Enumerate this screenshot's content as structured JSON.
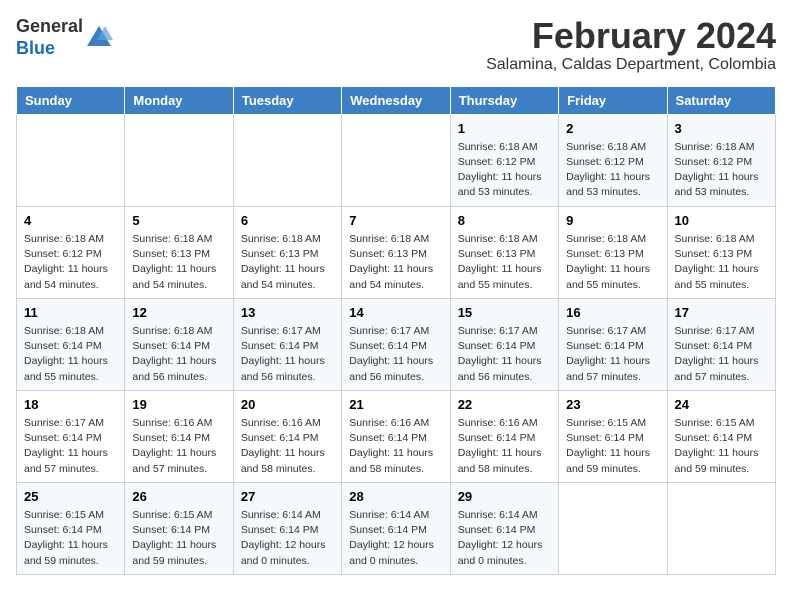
{
  "header": {
    "logo_general": "General",
    "logo_blue": "Blue",
    "month_year": "February 2024",
    "location": "Salamina, Caldas Department, Colombia"
  },
  "weekdays": [
    "Sunday",
    "Monday",
    "Tuesday",
    "Wednesday",
    "Thursday",
    "Friday",
    "Saturday"
  ],
  "weeks": [
    [
      {
        "day": "",
        "info": ""
      },
      {
        "day": "",
        "info": ""
      },
      {
        "day": "",
        "info": ""
      },
      {
        "day": "",
        "info": ""
      },
      {
        "day": "1",
        "info": "Sunrise: 6:18 AM\nSunset: 6:12 PM\nDaylight: 11 hours\nand 53 minutes."
      },
      {
        "day": "2",
        "info": "Sunrise: 6:18 AM\nSunset: 6:12 PM\nDaylight: 11 hours\nand 53 minutes."
      },
      {
        "day": "3",
        "info": "Sunrise: 6:18 AM\nSunset: 6:12 PM\nDaylight: 11 hours\nand 53 minutes."
      }
    ],
    [
      {
        "day": "4",
        "info": "Sunrise: 6:18 AM\nSunset: 6:12 PM\nDaylight: 11 hours\nand 54 minutes."
      },
      {
        "day": "5",
        "info": "Sunrise: 6:18 AM\nSunset: 6:13 PM\nDaylight: 11 hours\nand 54 minutes."
      },
      {
        "day": "6",
        "info": "Sunrise: 6:18 AM\nSunset: 6:13 PM\nDaylight: 11 hours\nand 54 minutes."
      },
      {
        "day": "7",
        "info": "Sunrise: 6:18 AM\nSunset: 6:13 PM\nDaylight: 11 hours\nand 54 minutes."
      },
      {
        "day": "8",
        "info": "Sunrise: 6:18 AM\nSunset: 6:13 PM\nDaylight: 11 hours\nand 55 minutes."
      },
      {
        "day": "9",
        "info": "Sunrise: 6:18 AM\nSunset: 6:13 PM\nDaylight: 11 hours\nand 55 minutes."
      },
      {
        "day": "10",
        "info": "Sunrise: 6:18 AM\nSunset: 6:13 PM\nDaylight: 11 hours\nand 55 minutes."
      }
    ],
    [
      {
        "day": "11",
        "info": "Sunrise: 6:18 AM\nSunset: 6:14 PM\nDaylight: 11 hours\nand 55 minutes."
      },
      {
        "day": "12",
        "info": "Sunrise: 6:18 AM\nSunset: 6:14 PM\nDaylight: 11 hours\nand 56 minutes."
      },
      {
        "day": "13",
        "info": "Sunrise: 6:17 AM\nSunset: 6:14 PM\nDaylight: 11 hours\nand 56 minutes."
      },
      {
        "day": "14",
        "info": "Sunrise: 6:17 AM\nSunset: 6:14 PM\nDaylight: 11 hours\nand 56 minutes."
      },
      {
        "day": "15",
        "info": "Sunrise: 6:17 AM\nSunset: 6:14 PM\nDaylight: 11 hours\nand 56 minutes."
      },
      {
        "day": "16",
        "info": "Sunrise: 6:17 AM\nSunset: 6:14 PM\nDaylight: 11 hours\nand 57 minutes."
      },
      {
        "day": "17",
        "info": "Sunrise: 6:17 AM\nSunset: 6:14 PM\nDaylight: 11 hours\nand 57 minutes."
      }
    ],
    [
      {
        "day": "18",
        "info": "Sunrise: 6:17 AM\nSunset: 6:14 PM\nDaylight: 11 hours\nand 57 minutes."
      },
      {
        "day": "19",
        "info": "Sunrise: 6:16 AM\nSunset: 6:14 PM\nDaylight: 11 hours\nand 57 minutes."
      },
      {
        "day": "20",
        "info": "Sunrise: 6:16 AM\nSunset: 6:14 PM\nDaylight: 11 hours\nand 58 minutes."
      },
      {
        "day": "21",
        "info": "Sunrise: 6:16 AM\nSunset: 6:14 PM\nDaylight: 11 hours\nand 58 minutes."
      },
      {
        "day": "22",
        "info": "Sunrise: 6:16 AM\nSunset: 6:14 PM\nDaylight: 11 hours\nand 58 minutes."
      },
      {
        "day": "23",
        "info": "Sunrise: 6:15 AM\nSunset: 6:14 PM\nDaylight: 11 hours\nand 59 minutes."
      },
      {
        "day": "24",
        "info": "Sunrise: 6:15 AM\nSunset: 6:14 PM\nDaylight: 11 hours\nand 59 minutes."
      }
    ],
    [
      {
        "day": "25",
        "info": "Sunrise: 6:15 AM\nSunset: 6:14 PM\nDaylight: 11 hours\nand 59 minutes."
      },
      {
        "day": "26",
        "info": "Sunrise: 6:15 AM\nSunset: 6:14 PM\nDaylight: 11 hours\nand 59 minutes."
      },
      {
        "day": "27",
        "info": "Sunrise: 6:14 AM\nSunset: 6:14 PM\nDaylight: 12 hours\nand 0 minutes."
      },
      {
        "day": "28",
        "info": "Sunrise: 6:14 AM\nSunset: 6:14 PM\nDaylight: 12 hours\nand 0 minutes."
      },
      {
        "day": "29",
        "info": "Sunrise: 6:14 AM\nSunset: 6:14 PM\nDaylight: 12 hours\nand 0 minutes."
      },
      {
        "day": "",
        "info": ""
      },
      {
        "day": "",
        "info": ""
      }
    ]
  ]
}
